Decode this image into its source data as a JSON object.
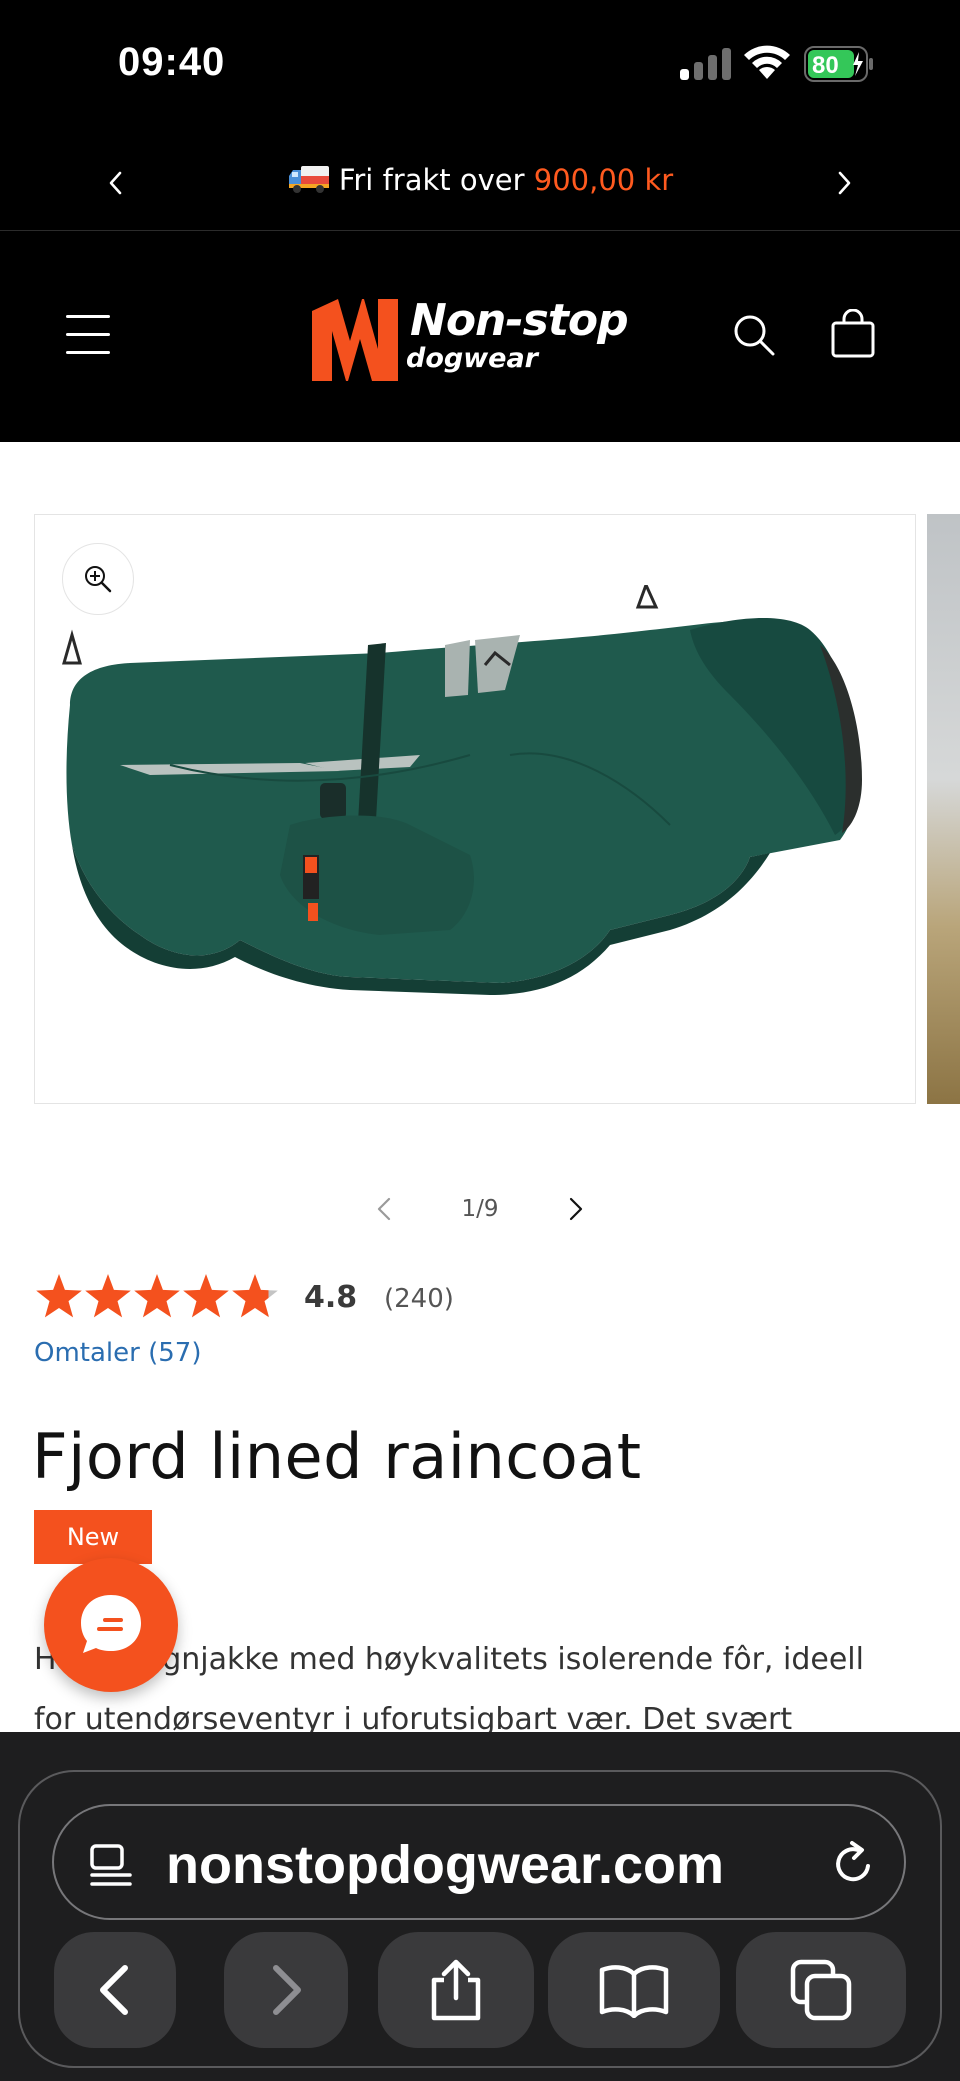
{
  "status_bar": {
    "time": "09:40",
    "battery": "80"
  },
  "announcement": {
    "text": "Fri frakt over ",
    "price": "900,00 kr"
  },
  "header": {
    "logo_line1": "Non-stop",
    "logo_line2": "dogwear"
  },
  "gallery": {
    "counter": "1/9"
  },
  "rating": {
    "stars": 4.8,
    "value": "4.8",
    "count": "(240)",
    "reviews_link": "Omtaler (57)"
  },
  "product": {
    "title": "Fjord lined raincoat",
    "badge": "New",
    "description": "Hunderegnjakke med høykvalitets isolerende fôr, ideell for utendørseventyr i uforutsigbart vær. Det svært"
  },
  "browser": {
    "url": "nonstopdogwear.com"
  },
  "colors": {
    "accent": "#f4511e",
    "coat": "#1f5a4d",
    "link": "#2a6db0",
    "battery_green": "#34c759"
  }
}
